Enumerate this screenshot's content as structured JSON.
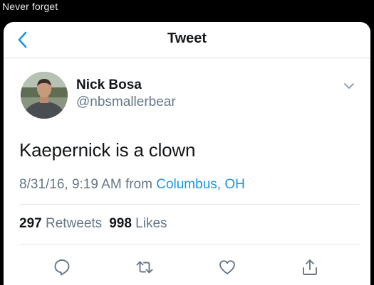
{
  "caption": "Never forget",
  "header": {
    "title": "Tweet"
  },
  "author": {
    "name": "Nick Bosa",
    "handle": "@nbsmallerbear"
  },
  "tweet": {
    "text": "Kaepernick is a clown",
    "timestamp": "8/31/16, 9:19 AM",
    "from_label": "from",
    "location": "Columbus, OH"
  },
  "stats": {
    "retweets_count": "297",
    "retweets_label": "Retweets",
    "likes_count": "998",
    "likes_label": "Likes"
  },
  "colors": {
    "accent": "#1b95e0",
    "text": "#14171a",
    "muted": "#657786",
    "icon": "#657786"
  },
  "icons": [
    "back-arrow-icon",
    "chevron-down-icon",
    "reply-icon",
    "retweet-icon",
    "like-icon",
    "share-icon"
  ]
}
